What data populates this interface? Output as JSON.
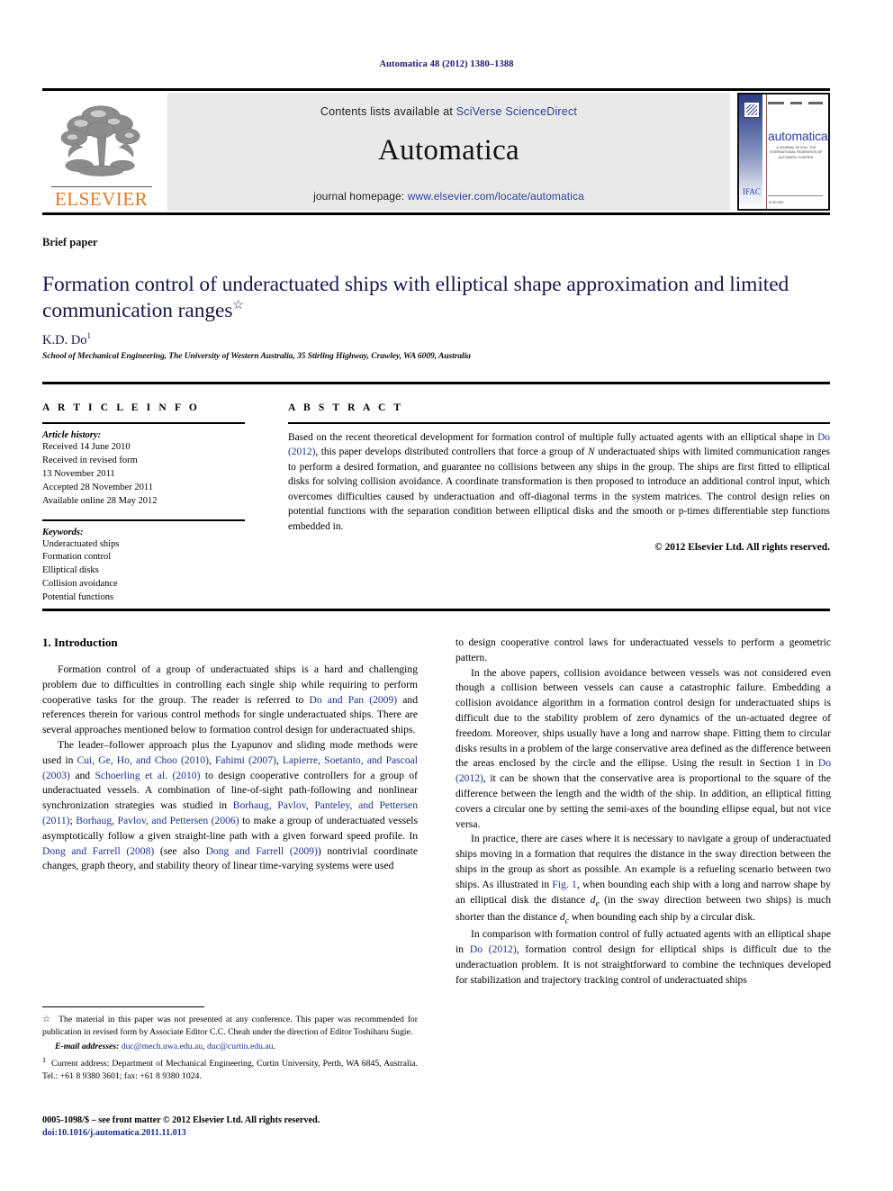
{
  "running_head": "Automatica 48 (2012) 1380–1388",
  "masthead": {
    "contents_prefix": "Contents lists available at ",
    "sciencedirect": "SciVerse ScienceDirect",
    "journal_name": "Automatica",
    "homepage_prefix": "journal homepage: ",
    "homepage_url": "www.elsevier.com/locate/automatica",
    "publisher_wordmark": "ELSEVIER",
    "cover": {
      "title": "automatica",
      "subtitle": "A JOURNAL OF IFAC, THE INTERNATIONAL FEDERATION OF AUTOMATIC CONTROL",
      "footer_text": "ELSEVIER",
      "seal": "IFAC"
    },
    "link_color": "#2b3fa0",
    "wordmark_color": "#E87722"
  },
  "article": {
    "type_label": "Brief paper",
    "title": "Formation control of underactuated ships with elliptical shape approximation and limited communication ranges",
    "title_footnote_marker": "☆",
    "author": "K.D. Do",
    "author_footnote_marker": "1",
    "affiliation": "School of Mechanical Engineering, The University of Western Australia, 35 Stirling Highway, Crawley, WA 6009, Australia",
    "title_color": "#18184a"
  },
  "article_info": {
    "heading": "A R T I C L E   I N F O",
    "history_heading": "Article history:",
    "history": [
      "Received 14 June 2010",
      "Received in revised form",
      "13 November 2011",
      "Accepted 28 November 2011",
      "Available online 28 May 2012"
    ],
    "keywords_heading": "Keywords:",
    "keywords": [
      "Underactuated ships",
      "Formation control",
      "Elliptical disks",
      "Collision avoidance",
      "Potential functions"
    ]
  },
  "abstract": {
    "heading": "A B S T R A C T",
    "part1": "Based on the recent theoretical development for formation control of multiple fully actuated agents with an elliptical shape in ",
    "citation": "Do (2012)",
    "part2": ", this paper develops distributed controllers that force a group of ",
    "math_n": "N",
    "part3": " underactuated ships with limited communication ranges to perform a desired formation, and guarantee no collisions between any ships in the group. The ships are first fitted to elliptical disks for solving collision avoidance. A coordinate transformation is then proposed to introduce an additional control input, which overcomes difficulties caused by underactuation and off-diagonal terms in the system matrices. The control design relies on potential functions with the separation condition between elliptical disks and the smooth or p-times differentiable step functions embedded in.",
    "copyright": "© 2012 Elsevier Ltd. All rights reserved."
  },
  "body": {
    "section_title": "1. Introduction",
    "left": {
      "p1_a": "Formation control of a group of underactuated ships is a hard and challenging problem due to difficulties in controlling each single ship while requiring to perform cooperative tasks for the group. The reader is referred to ",
      "p1_cite1": "Do and Pan (2009)",
      "p1_b": " and references therein for various control methods for single underactuated ships. There are several approaches mentioned below to formation control design for underactuated ships.",
      "p2_a": "The leader–follower approach plus the Lyapunov and sliding mode methods were used in ",
      "p2_cite1": "Cui, Ge, Ho, and Choo (2010)",
      "p2_b": ", ",
      "p2_cite2": "Fahimi (2007)",
      "p2_c": ", ",
      "p2_cite3": "Lapierre, Soetanto, and Pascoal (2003)",
      "p2_d": " and ",
      "p2_cite4": "Schoerling et al. (2010)",
      "p2_e": " to design cooperative controllers for a group of underactuated vessels. A combination of line-of-sight path-following and nonlinear synchronization strategies was studied in ",
      "p2_cite5": "Borhaug, Pavlov, Panteley, and Pettersen (2011)",
      "p2_f": "; ",
      "p2_cite6": "Borhaug, Pavlov, and Pettersen (2006)",
      "p2_g": " to make a group of underactuated vessels asymptotically follow a given straight-line path with a given forward speed profile. In ",
      "p2_cite7": "Dong and Farrell (2008)",
      "p2_h": " (see also ",
      "p2_cite8": "Dong and Farrell (2009)",
      "p2_i": ") nontrivial coordinate changes, graph theory, and stability theory of linear time-varying systems were used"
    },
    "right": {
      "p1": "to design cooperative control laws for underactuated vessels to perform a geometric pattern.",
      "p2_a": "In the above papers, collision avoidance between vessels was not considered even though a collision between vessels can cause a catastrophic failure. Embedding a collision avoidance algorithm in a formation control design for underactuated ships is difficult due to the stability problem of zero dynamics of the un-actuated degree of freedom. Moreover, ships usually have a long and narrow shape. Fitting them to circular disks results in a problem of the large conservative area defined as the difference between the areas enclosed by the circle and the ellipse. Using the result in Section 1 in ",
      "p2_cite1": "Do (2012)",
      "p2_b": ", it can be shown that the conservative area is proportional to the square of the difference between the length and the width of the ship. In addition, an elliptical fitting covers a circular one by setting the semi-axes of the bounding ellipse equal, but not vice versa.",
      "p3_a": "In practice, there are cases where it is necessary to navigate a group of underactuated ships moving in a formation that requires the distance in the sway direction between the ships in the group as short as possible. An example is a refueling scenario between two ships. As illustrated in ",
      "p3_cite1": "Fig. 1",
      "p3_b": ", when bounding each ship with a long and narrow shape by an elliptical disk the distance ",
      "p3_math1": "d",
      "p3_math1_sub": "e",
      "p3_c": " (in the sway direction between two ships) is much shorter than the distance ",
      "p3_math2": "d",
      "p3_math2_sub": "c",
      "p3_d": " when bounding each ship by a circular disk.",
      "p4_a": "In comparison with formation control of fully actuated agents with an elliptical shape in ",
      "p4_cite1": "Do (2012)",
      "p4_b": ", formation control design for elliptical ships is difficult due to the underactuation problem. It is not straightforward to combine the techniques developed for stabilization and trajectory tracking control of underactuated ships"
    }
  },
  "footnotes": {
    "star_marker": "☆",
    "star_text": "The material in this paper was not presented at any conference. This paper was recommended for publication in revised form by Associate Editor C.C. Cheah under the direction of Editor Toshiharu Sugie.",
    "email_label": "E-mail addresses:",
    "email1": "duc@mech.uwa.edu.au",
    "email_sep": ", ",
    "email2": "duc@curtin.edu.au",
    "email_end": ".",
    "num_marker": "1",
    "num_text": "Current address: Department of Mechanical Engineering, Curtin University, Perth, WA 6845, Australia. Tel.: +61 8 9380 3601; fax: +61 8 9380 1024."
  },
  "footer": {
    "issn_line": "0005-1098/$ – see front matter © 2012 Elsevier Ltd. All rights reserved.",
    "doi": "doi:10.1016/j.automatica.2011.11.013"
  }
}
